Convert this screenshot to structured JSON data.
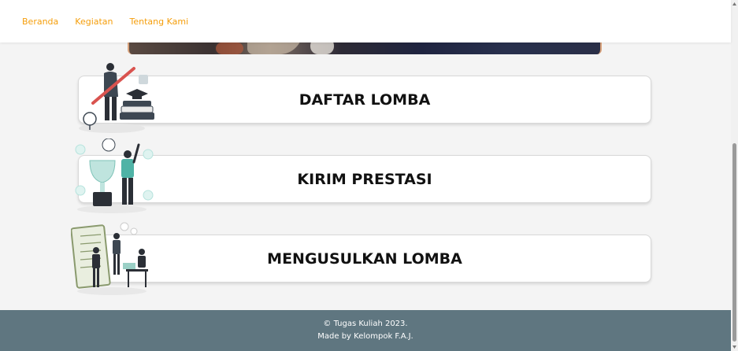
{
  "nav": {
    "links": [
      "Beranda",
      "Kegiatan",
      "Tentang Kami"
    ]
  },
  "cards": [
    {
      "title": "DAFTAR LOMBA",
      "illustration": "student-graduation-illustration"
    },
    {
      "title": "KIRIM PRESTASI",
      "illustration": "trophy-achievement-illustration"
    },
    {
      "title": "MENGUSULKAN LOMBA",
      "illustration": "team-planning-illustration"
    }
  ],
  "footer": {
    "line1": "© Tugas Kuliah 2023.",
    "line2": "Made by Kelompok F.A.J."
  },
  "colors": {
    "nav_link": "#f59e0b",
    "footer_bg": "#5f7680",
    "page_bg": "#f4f4f4"
  }
}
